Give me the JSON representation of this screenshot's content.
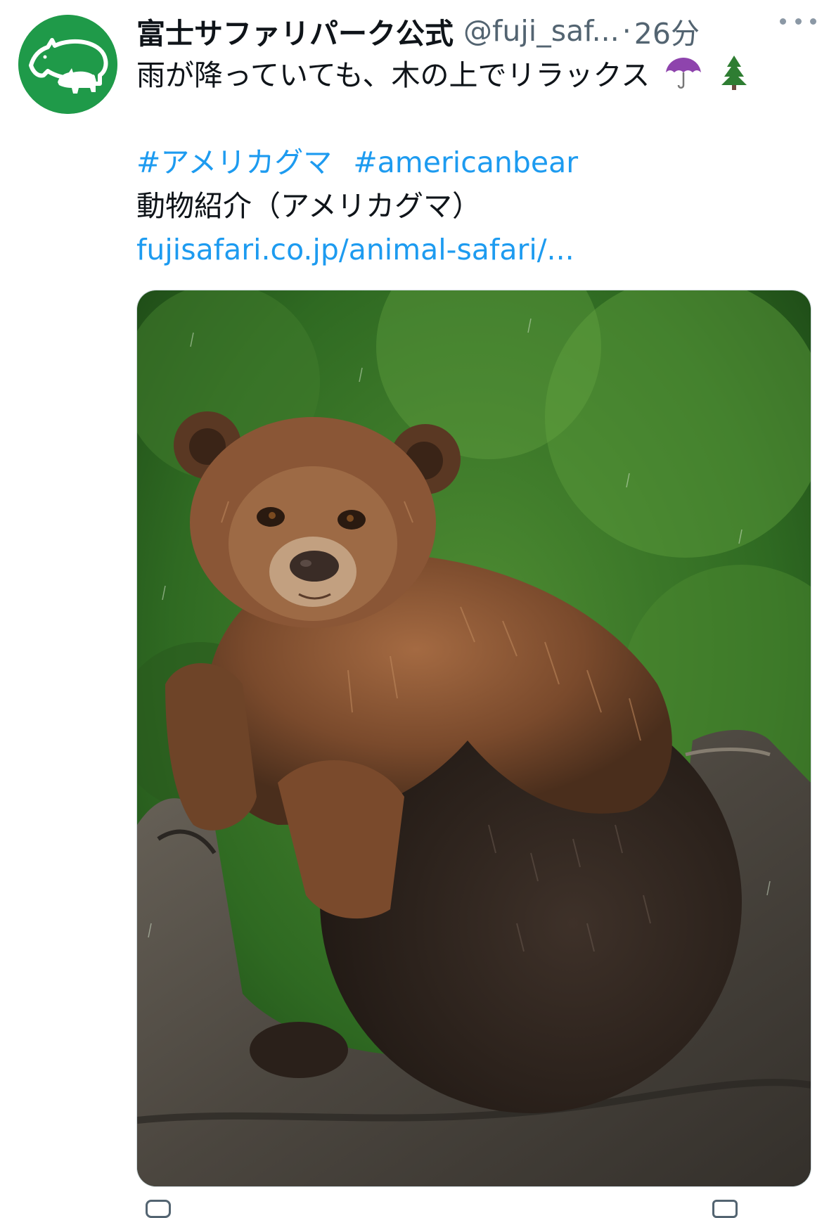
{
  "tweet": {
    "display_name": "富士サファリパーク公式",
    "handle": "@fuji_saf...",
    "separator": "·",
    "timestamp": "26分",
    "text_line1": "雨が降っていても、木の上でリラックス",
    "emoji_umbrella": "☂️",
    "emoji_tree": "🌲",
    "hashtags": [
      "#アメリカグマ",
      "#americanbear"
    ],
    "text_line3": "動物紹介（アメリカグマ）",
    "link": "fujisafari.co.jp/animal-safari/...",
    "more_icon": "more-horizontal-icon",
    "colors": {
      "avatar_green": "#1f9a49",
      "link_blue": "#1d9bf0",
      "muted_gray": "#536471"
    }
  },
  "media": {
    "subject": "bear-photo",
    "icons": [
      "reply-icon",
      "share-icon"
    ]
  }
}
